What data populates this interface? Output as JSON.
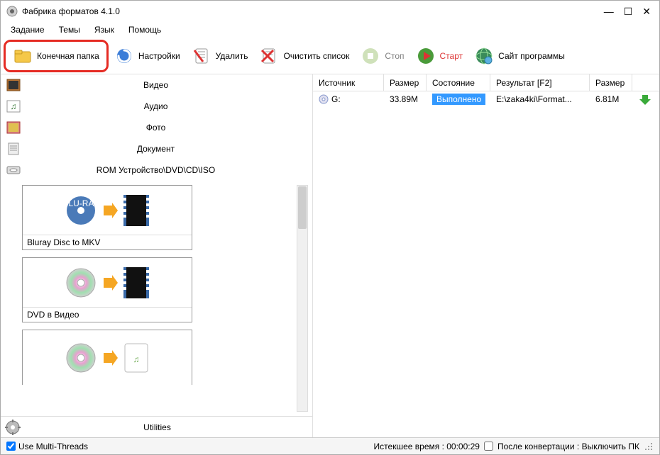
{
  "window": {
    "title": "Фабрика форматов 4.1.0"
  },
  "menu": {
    "task": "Задание",
    "themes": "Темы",
    "language": "Язык",
    "help": "Помощь"
  },
  "toolbar": {
    "output_folder": "Конечная папка",
    "settings": "Настройки",
    "delete": "Удалить",
    "clear_list": "Очистить список",
    "stop": "Стоп",
    "start": "Старт",
    "website": "Сайт программы"
  },
  "categories": {
    "video": "Видео",
    "audio": "Аудио",
    "photo": "Фото",
    "document": "Документ",
    "rom": "ROM Устройство\\DVD\\CD\\ISO"
  },
  "presets": {
    "bluray_mkv": "Bluray Disc to MKV",
    "dvd_video": "DVD в Видео"
  },
  "utilities": "Utilities",
  "table": {
    "headers": {
      "source": "Источник",
      "size": "Размер",
      "state": "Состояние",
      "result": "Результат [F2]",
      "size2": "Размер"
    },
    "row": {
      "source": "G:",
      "size": "33.89M",
      "state": "Выполнено",
      "result": "E:\\zaka4ki\\Format...",
      "size2": "6.81M"
    }
  },
  "status": {
    "multithread": "Use Multi-Threads",
    "elapsed": "Истекшее время : 00:00:29",
    "after_convert": "После конвертации : Выключить ПК"
  }
}
